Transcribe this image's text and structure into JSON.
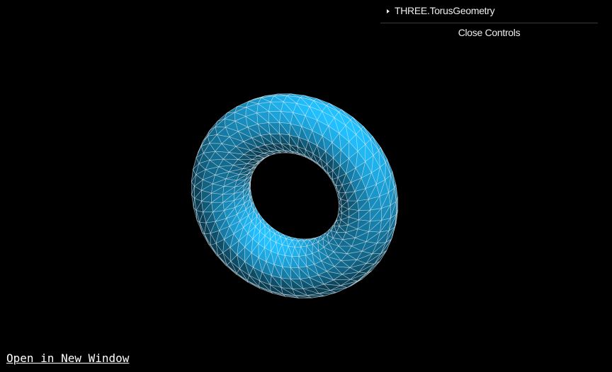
{
  "gui": {
    "folder_label": "THREE.TorusGeometry",
    "close_label": "Close Controls"
  },
  "footer": {
    "open_link_label": "Open in New Window"
  },
  "viewport": {
    "background": "#000000",
    "mesh_color": "#1fb5f2",
    "wireframe_color": "#ffffff"
  }
}
